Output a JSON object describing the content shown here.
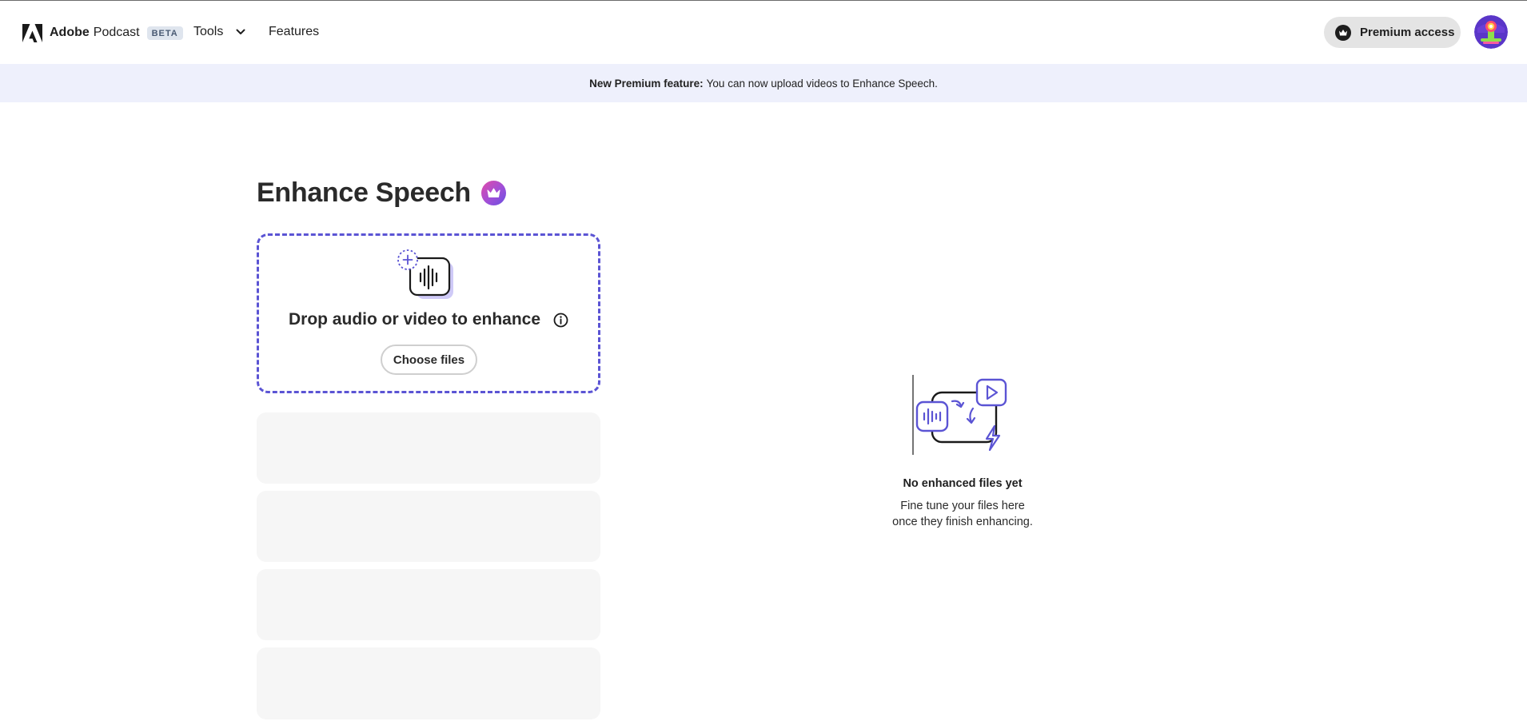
{
  "header": {
    "brand_adobe": "Adobe",
    "brand_podcast": "Podcast",
    "beta_badge": "BETA",
    "nav": {
      "tools": "Tools",
      "features": "Features"
    },
    "premium_label": "Premium access"
  },
  "banner": {
    "bold": "New Premium feature:",
    "text": "You can now upload videos to Enhance Speech."
  },
  "main": {
    "title": "Enhance Speech",
    "dropzone": {
      "label": "Drop audio or video to enhance",
      "button": "Choose files"
    },
    "empty_state": {
      "title": "No enhanced files yet",
      "line1": "Fine tune your files here",
      "line2": "once they finish enhancing."
    }
  },
  "icons": [
    "adobe-logo",
    "chevron-down-icon",
    "premium-icon",
    "avatar",
    "crown-icon",
    "upload-audio-icon",
    "info-icon",
    "empty-state-illustration"
  ],
  "colors": {
    "accent": "#5b54d4",
    "banner_bg": "#eef0fc",
    "premium_bg": "#e4e4e4",
    "skeleton": "#f6f6f6"
  }
}
